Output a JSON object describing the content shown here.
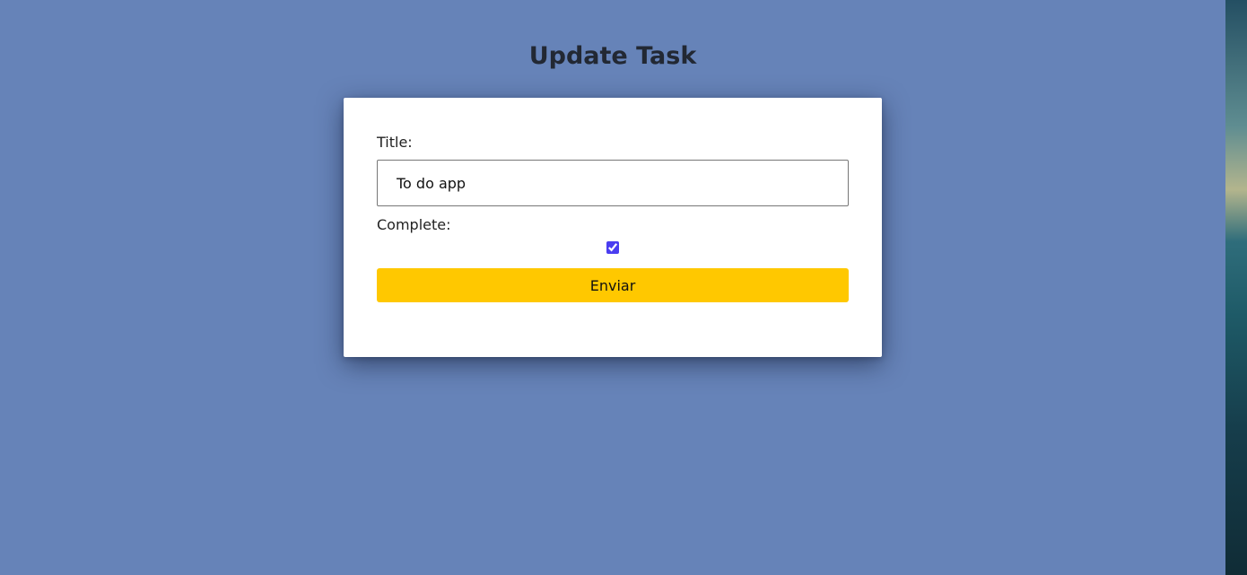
{
  "page": {
    "title": "Update Task"
  },
  "form": {
    "title_label": "Title:",
    "title_value": "To do app",
    "complete_label": "Complete:",
    "complete_checked": true,
    "submit_label": "Enviar"
  },
  "colors": {
    "background": "#6683b8",
    "card": "#ffffff",
    "button": "#ffc800",
    "checkbox_accent": "#4a3df0"
  }
}
